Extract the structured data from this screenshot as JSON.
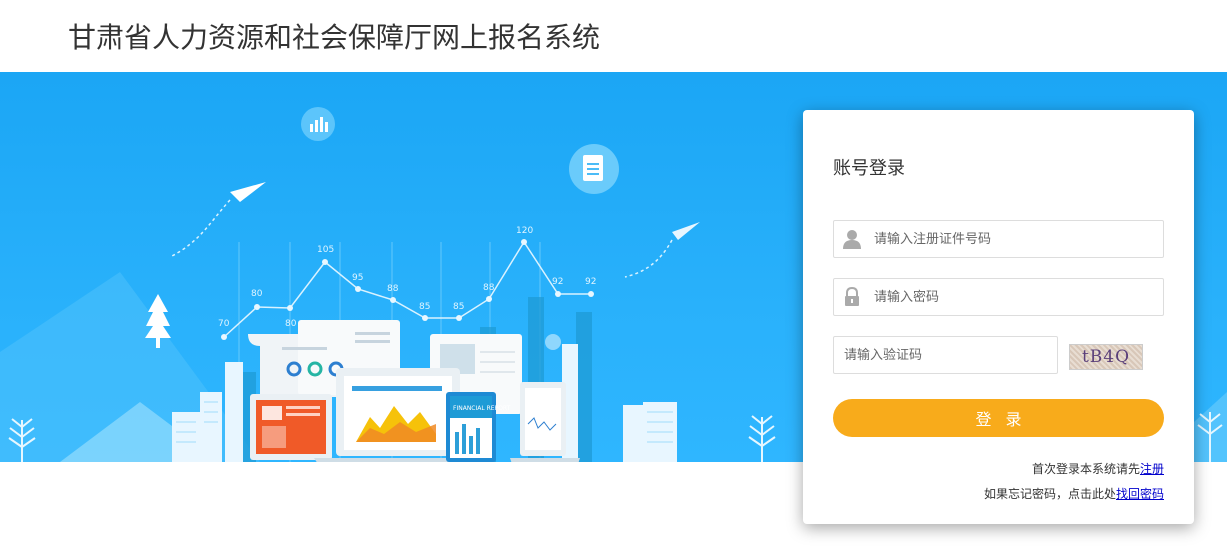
{
  "header": {
    "title": "甘肃省人力资源和社会保障厅网上报名系统"
  },
  "banner": {
    "chart_labels": [
      "70",
      "80",
      "80",
      "105",
      "95",
      "88",
      "85",
      "85",
      "88",
      "120",
      "92",
      "92"
    ],
    "report_label": "FINANCIAL REPORT"
  },
  "login": {
    "title": "账号登录",
    "username_placeholder": "请输入注册证件号码",
    "password_placeholder": "请输入密码",
    "captcha_placeholder": "请输入验证码",
    "captcha_text": "tB4Q",
    "submit_label": "登录",
    "first_time_text": "首次登录本系统请先",
    "register_link": "注册",
    "forgot_text": "如果忘记密码，点击此处",
    "recover_link": "找回密码"
  },
  "colors": {
    "banner": "#29b1fb",
    "button": "#f8ab1b",
    "link": "#0000cc"
  }
}
